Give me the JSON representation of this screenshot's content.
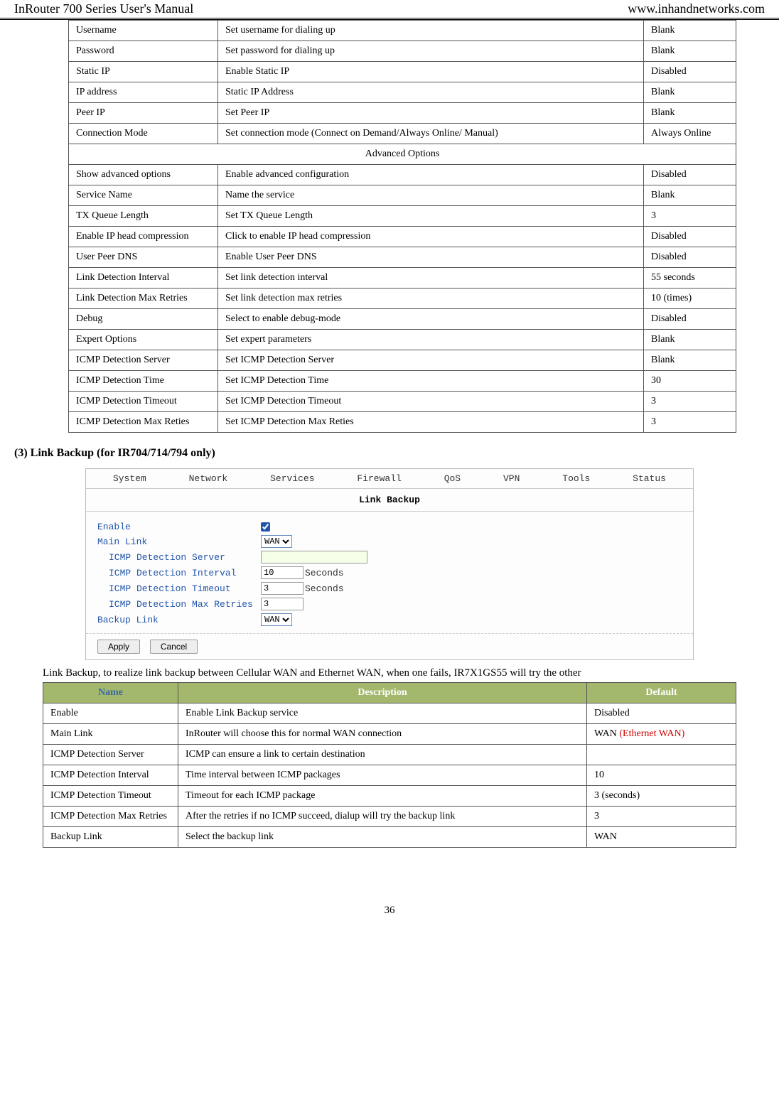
{
  "header": {
    "left": "InRouter 700 Series User's Manual",
    "right": "www.inhandnetworks.com"
  },
  "table1": {
    "rows": [
      {
        "name": "Username",
        "desc": "Set username for dialing up",
        "def": "Blank"
      },
      {
        "name": "Password",
        "desc": "Set password for dialing up",
        "def": "Blank"
      },
      {
        "name": "Static IP",
        "desc": "Enable Static IP",
        "def": "Disabled"
      },
      {
        "name": "IP address",
        "desc": "Static IP Address",
        "def": "Blank"
      },
      {
        "name": "Peer IP",
        "desc": "Set Peer IP",
        "def": "Blank"
      },
      {
        "name": "Connection Mode",
        "desc": "Set connection mode (Connect on Demand/Always Online/ Manual)",
        "def": "Always Online"
      }
    ],
    "advanced_header": "Advanced Options",
    "rows2": [
      {
        "name": "Show advanced options",
        "desc": "Enable advanced configuration",
        "def": "Disabled"
      },
      {
        "name": "Service Name",
        "desc": "Name the service",
        "def": "Blank"
      },
      {
        "name": "TX Queue Length",
        "desc": "Set TX Queue Length",
        "def": "3"
      },
      {
        "name": "Enable IP head compression",
        "desc": "Click to enable IP head compression",
        "def": "Disabled"
      },
      {
        "name": "User Peer DNS",
        "desc": "Enable User Peer DNS",
        "def": "Disabled"
      },
      {
        "name": "Link Detection Interval",
        "desc": "Set link detection interval",
        "def": "55 seconds"
      },
      {
        "name": "Link Detection Max Retries",
        "desc": "Set link detection max retries",
        "def": "10 (times)"
      },
      {
        "name": "Debug",
        "desc": "Select to enable debug-mode",
        "def": "Disabled"
      },
      {
        "name": "Expert Options",
        "desc": "Set expert parameters",
        "def": "Blank"
      },
      {
        "name": "ICMP Detection Server",
        "desc": "Set ICMP Detection Server",
        "def": "Blank"
      },
      {
        "name": "ICMP Detection Time",
        "desc": "Set ICMP Detection Time",
        "def": "30"
      },
      {
        "name": "ICMP Detection Timeout",
        "desc": "Set ICMP Detection Timeout",
        "def": "3"
      },
      {
        "name": "ICMP Detection Max Reties",
        "desc": "Set ICMP Detection Max Reties",
        "def": "3"
      }
    ]
  },
  "section3": {
    "heading": "(3)   Link Backup (for IR704/714/794 only)"
  },
  "screenshot": {
    "menus": [
      "System",
      "Network",
      "Services",
      "Firewall",
      "QoS",
      "VPN",
      "Tools",
      "Status"
    ],
    "title": "Link Backup",
    "form": {
      "enable_label": "Enable",
      "enable_checked": true,
      "mainlink_label": "Main Link",
      "mainlink_value": "WAN",
      "icmp_server_label": "ICMP Detection Server",
      "icmp_server_value": "",
      "icmp_interval_label": "ICMP Detection Interval",
      "icmp_interval_value": "10",
      "icmp_timeout_label": "ICMP Detection Timeout",
      "icmp_timeout_value": "3",
      "icmp_maxretries_label": "ICMP Detection Max Retries",
      "icmp_maxretries_value": "3",
      "backup_label": "Backup Link",
      "backup_value": "WAN",
      "seconds_unit": "Seconds",
      "apply": "Apply",
      "cancel": "Cancel"
    }
  },
  "caption2": {
    "prefix": "Link Backup, to realize link backup between Cellular WAN and Ethernet WAN, when one fails, IR7X1GS55 will try the other"
  },
  "table2": {
    "headers": {
      "name": "Name",
      "desc": "Description",
      "def": "Default"
    },
    "rows": [
      {
        "name": "Enable",
        "desc": "Enable Link Backup service",
        "def": "Disabled"
      },
      {
        "name": "Main Link",
        "desc": "InRouter will choose this for normal WAN connection",
        "def": "WAN",
        "def_suffix_red": " (Ethernet WAN)"
      },
      {
        "name": "ICMP Detection Server",
        "desc": "ICMP can ensure a link to certain destination",
        "def": ""
      },
      {
        "name": "ICMP Detection Interval",
        "desc": "Time interval between ICMP packages",
        "def": "10"
      },
      {
        "name": "ICMP Detection Timeout",
        "desc": "Timeout for each ICMP package",
        "def": "3 (seconds)"
      },
      {
        "name": "ICMP Detection Max Retries",
        "desc": "After the retries if no ICMP succeed, dialup will try the backup link",
        "def": "3"
      },
      {
        "name": "Backup Link",
        "desc": "Select the backup link",
        "def": "WAN"
      }
    ]
  },
  "page_number": "36"
}
